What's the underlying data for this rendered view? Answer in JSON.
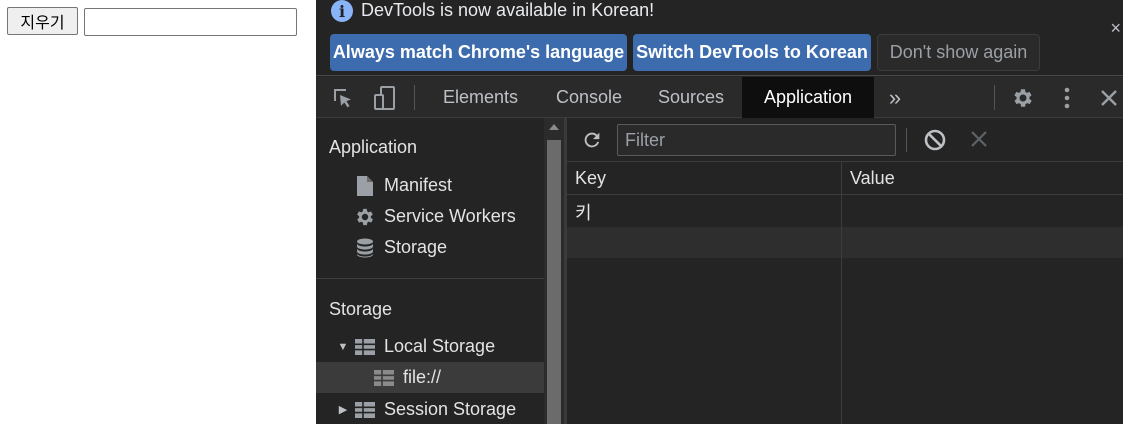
{
  "page": {
    "clear_button": "지우기",
    "input_value": "",
    "input_placeholder": ""
  },
  "infobar": {
    "message": "DevTools is now available in Korean!",
    "buttons": {
      "match": "Always match Chrome's language",
      "switch": "Switch DevTools to Korean",
      "dont": "Don't show again"
    },
    "close": "×"
  },
  "tabs": [
    {
      "label": "Elements"
    },
    {
      "label": "Console"
    },
    {
      "label": "Sources"
    },
    {
      "label": "Application"
    }
  ],
  "tabs_more": "»",
  "active_tab": "Application",
  "sidebar": {
    "application_title": "Application",
    "application_items": [
      {
        "label": "Manifest",
        "icon": "file-icon"
      },
      {
        "label": "Service Workers",
        "icon": "gear-icon"
      },
      {
        "label": "Storage",
        "icon": "database-icon"
      }
    ],
    "storage_title": "Storage",
    "storage_items": [
      {
        "label": "Local Storage",
        "icon": "table-icon",
        "expanded": true
      },
      {
        "label": "file://",
        "icon": "table-icon",
        "selected": true
      },
      {
        "label": "Session Storage",
        "icon": "table-icon",
        "expanded": false
      }
    ]
  },
  "storage_view": {
    "filter_placeholder": "Filter",
    "filter_value": "",
    "columns": [
      "Key",
      "Value"
    ],
    "rows": [
      {
        "key": "키",
        "value": ""
      },
      {
        "key": "",
        "value": ""
      }
    ]
  },
  "colors": {
    "accent": "#3d6cae",
    "info_icon": "#8ab4f8",
    "devtools_bg": "#242424",
    "active_tab_bg": "#0e0e0e"
  }
}
